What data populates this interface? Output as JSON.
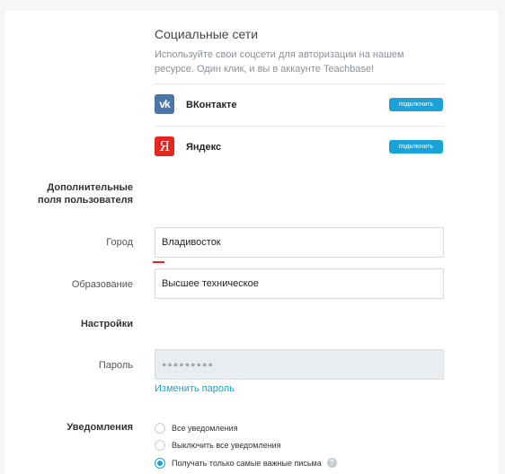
{
  "social": {
    "title": "Социальные сети",
    "description": "Используйте свои соцсети для авторизации на нашем ресурсе. Один клик, и вы в аккаунте Teachbase!",
    "networks": [
      {
        "name": "ВКонтакте",
        "icon": "vk-icon",
        "icon_text": "vk",
        "button": "подключить"
      },
      {
        "name": "Яндекс",
        "icon": "yandex-icon",
        "icon_text": "Я",
        "button": "подключить"
      }
    ]
  },
  "extra_fields": {
    "heading": "Дополнительные поля пользователя",
    "city": {
      "label": "Город",
      "value": "Владивосток"
    },
    "education": {
      "label": "Образование",
      "value": "Высшее техническое"
    }
  },
  "settings": {
    "heading": "Настройки",
    "password": {
      "label": "Пароль",
      "value": "●●●●●●●●●"
    },
    "change_password_link": "Изменить пароль"
  },
  "notifications": {
    "label": "Уведомления",
    "options": [
      {
        "label": "Все уведомления",
        "checked": false
      },
      {
        "label": "Выключить все уведомления",
        "checked": false
      },
      {
        "label": "Получать только самые важные письма",
        "checked": true,
        "help_icon": "?"
      }
    ]
  },
  "colors": {
    "accent": "#1aa1d8",
    "vk": "#4a76a8",
    "yandex": "#e52620",
    "error_underline": "#e0242a"
  }
}
